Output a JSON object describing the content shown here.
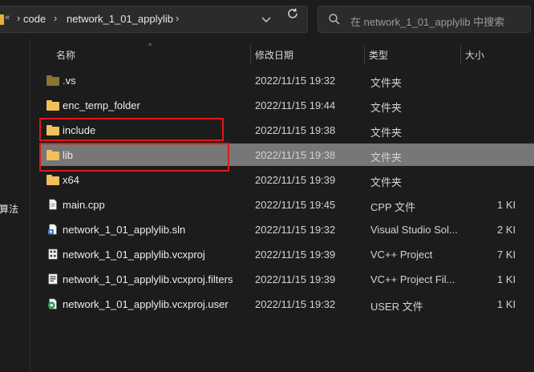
{
  "address_bar": {
    "overflow_label": "«",
    "crumbs": [
      "code",
      "network_1_01_applylib"
    ],
    "separator": "›"
  },
  "search": {
    "placeholder": "在 network_1_01_applylib 中搜索"
  },
  "left_pane": {
    "clipped_text": "算法"
  },
  "columns": {
    "name": "名称",
    "date": "修改日期",
    "type": "类型",
    "size": "大小"
  },
  "files": [
    {
      "name": ".vs",
      "date": "2022/11/15 19:32",
      "type": "文件夹",
      "size": "",
      "icon": "folder-dark-icon"
    },
    {
      "name": "enc_temp_folder",
      "date": "2022/11/15 19:44",
      "type": "文件夹",
      "size": "",
      "icon": "folder-icon"
    },
    {
      "name": "include",
      "date": "2022/11/15 19:38",
      "type": "文件夹",
      "size": "",
      "icon": "folder-icon"
    },
    {
      "name": "lib",
      "date": "2022/11/15 19:38",
      "type": "文件夹",
      "size": "",
      "icon": "folder-icon"
    },
    {
      "name": "x64",
      "date": "2022/11/15 19:39",
      "type": "文件夹",
      "size": "",
      "icon": "folder-icon"
    },
    {
      "name": "main.cpp",
      "date": "2022/11/15 19:45",
      "type": "CPP 文件",
      "size": "1 KI",
      "icon": "cpp-file-icon"
    },
    {
      "name": "network_1_01_applylib.sln",
      "date": "2022/11/15 19:32",
      "type": "Visual Studio Sol...",
      "size": "2 KI",
      "icon": "sln-file-icon"
    },
    {
      "name": "network_1_01_applylib.vcxproj",
      "date": "2022/11/15 19:39",
      "type": "VC++ Project",
      "size": "7 KI",
      "icon": "vcxproj-file-icon"
    },
    {
      "name": "network_1_01_applylib.vcxproj.filters",
      "date": "2022/11/15 19:39",
      "type": "VC++ Project Fil...",
      "size": "1 KI",
      "icon": "filters-file-icon"
    },
    {
      "name": "network_1_01_applylib.vcxproj.user",
      "date": "2022/11/15 19:32",
      "type": "USER 文件",
      "size": "1 KI",
      "icon": "user-file-icon"
    }
  ],
  "selected_file": "lib",
  "colors": {
    "accent_highlight": "#e01818",
    "folder": "#f0c05a",
    "selection": "#777777",
    "background": "#1c1c1c"
  }
}
